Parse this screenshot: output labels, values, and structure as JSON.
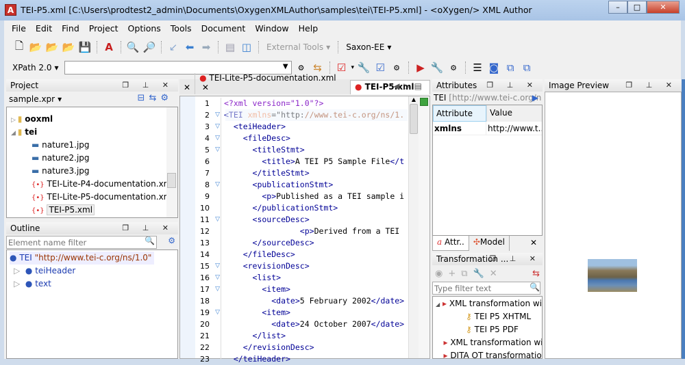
{
  "window": {
    "title": "TEI-P5.xml [C:\\Users\\prodtest2_admin\\Documents\\OxygenXMLAuthor\\samples\\tei\\TEI-P5.xml] - <oXygen/> XML Author",
    "app_icon": "A",
    "controls": [
      "minimize",
      "maximize",
      "close"
    ]
  },
  "menu": [
    "File",
    "Edit",
    "Find",
    "Project",
    "Options",
    "Tools",
    "Document",
    "Window",
    "Help"
  ],
  "toolbar1": {
    "external_tools": "External Tools",
    "transformer": "Saxon-EE"
  },
  "toolbar2": {
    "xpath_version": "XPath 2.0",
    "xpath_value": ""
  },
  "project": {
    "title": "Project",
    "project_file": "sample.xpr",
    "items": [
      {
        "label": "ooxml",
        "type": "folder",
        "bold": true,
        "level": 0,
        "expanded": false
      },
      {
        "label": "tei",
        "type": "folder",
        "bold": true,
        "level": 0,
        "expanded": true
      },
      {
        "label": "nature1.jpg",
        "type": "image",
        "level": 1
      },
      {
        "label": "nature2.jpg",
        "type": "image",
        "level": 1
      },
      {
        "label": "nature3.jpg",
        "type": "image",
        "level": 1
      },
      {
        "label": "TEI-Lite-P4-documentation.xml",
        "type": "xml",
        "level": 1
      },
      {
        "label": "TEI-Lite-P5-documentation.xml",
        "type": "xml",
        "level": 1
      },
      {
        "label": "TEI-P5.xml",
        "type": "xml",
        "level": 1,
        "selected": true
      }
    ]
  },
  "outline": {
    "title": "Outline",
    "filter_placeholder": "Element name filter",
    "root": {
      "name": "TEI",
      "ns": "\"http://www.tei-c.org/ns/1.0\""
    },
    "children": [
      "teiHeader",
      "text"
    ]
  },
  "editor": {
    "tabs": [
      {
        "label": "TEI-Lite-P5-documentation.xml",
        "active": false
      },
      {
        "label": "TEI-P5.xml",
        "active": true
      }
    ],
    "lines": [
      [
        [
          "pi",
          "<?xml version=\"1.0\"?>"
        ]
      ],
      [
        [
          "tag",
          "<TEI "
        ],
        [
          "an",
          "xmlns"
        ],
        [
          "tx",
          "=\"http:"
        ],
        [
          "av",
          "//www.tei-c.org/ns/1."
        ]
      ],
      [
        [
          "tag",
          "  <teiHeader>"
        ]
      ],
      [
        [
          "tag",
          "    <fileDesc>"
        ]
      ],
      [
        [
          "tag",
          "      <titleStmt>"
        ]
      ],
      [
        [
          "tag",
          "        <title>"
        ],
        [
          "tx",
          "A TEI P5 Sample File"
        ],
        [
          "tag",
          "</t"
        ]
      ],
      [
        [
          "tag",
          "      </titleStmt>"
        ]
      ],
      [
        [
          "tag",
          "      <publicationStmt>"
        ]
      ],
      [
        [
          "tag",
          "        <p>"
        ],
        [
          "tx",
          "Published as a TEI sample i"
        ]
      ],
      [
        [
          "tag",
          "      </publicationStmt>"
        ]
      ],
      [
        [
          "tag",
          "      <sourceDesc>"
        ]
      ],
      [
        [
          "tag",
          "                <p>"
        ],
        [
          "tx",
          "Derived from a TEI "
        ]
      ],
      [
        [
          "tag",
          "      </sourceDesc>"
        ]
      ],
      [
        [
          "tag",
          "    </fileDesc>"
        ]
      ],
      [
        [
          "tag",
          "    <revisionDesc>"
        ]
      ],
      [
        [
          "tag",
          "      <list>"
        ]
      ],
      [
        [
          "tag",
          "        <item>"
        ]
      ],
      [
        [
          "tag",
          "          <date>"
        ],
        [
          "tx",
          "5 February 2002"
        ],
        [
          "tag",
          "</date>"
        ]
      ],
      [
        [
          "tag",
          "        <item>"
        ]
      ],
      [
        [
          "tag",
          "          <date>"
        ],
        [
          "tx",
          "24 October 2007"
        ],
        [
          "tag",
          "</date>"
        ]
      ],
      [
        [
          "tag",
          "      </list>"
        ]
      ],
      [
        [
          "tag",
          "    </revisionDesc>"
        ]
      ],
      [
        [
          "tag",
          "  </teiHeader>"
        ]
      ]
    ],
    "foldable": [
      2,
      3,
      4,
      5,
      8,
      11,
      15,
      16,
      17,
      19
    ]
  },
  "attributes": {
    "title": "Attributes",
    "element": "TEI",
    "element_ns": "[http://www.tei-c.org/n",
    "columns": [
      "Attribute",
      "Value"
    ],
    "rows": [
      {
        "name": "xmlns",
        "value": "http://www.t..."
      }
    ],
    "tabs": [
      "Attr..",
      "Model"
    ]
  },
  "transformation": {
    "title": "Transformation ...",
    "filter_placeholder": "Type filter text",
    "items": [
      {
        "label": "XML transformation with XSLT",
        "level": 0,
        "type": "group"
      },
      {
        "label": "TEI P5 XHTML",
        "level": 1,
        "type": "scenario"
      },
      {
        "label": "TEI P5 PDF",
        "level": 1,
        "type": "scenario"
      },
      {
        "label": "XML transformation with XQuery",
        "level": 0,
        "type": "group"
      },
      {
        "label": "DITA OT transformation",
        "level": 0,
        "type": "group"
      }
    ]
  },
  "image_preview": {
    "title": "Image Preview"
  },
  "colors": {
    "accent": "#3a7fd0",
    "tag": "#000096",
    "attr": "#f5844c",
    "pi": "#8b26c9"
  }
}
